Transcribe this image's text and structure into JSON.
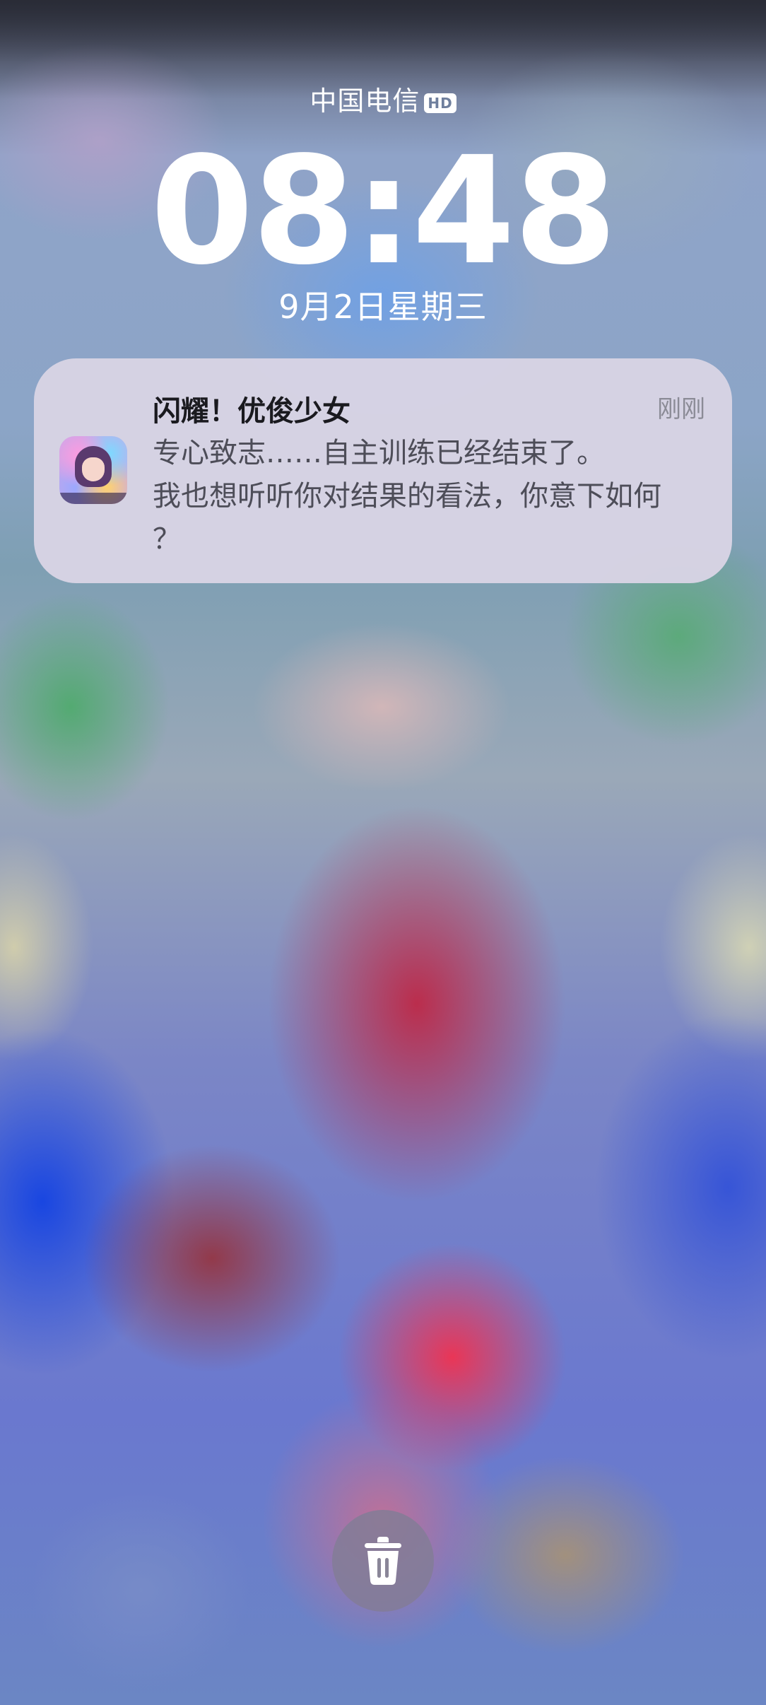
{
  "status": {
    "carrier": "中国电信",
    "network_badge": "HD"
  },
  "lockscreen": {
    "time": "08:48",
    "date": "9月2日星期三"
  },
  "notification": {
    "app_name": "闪耀！优俊少女",
    "timestamp": "刚刚",
    "message_lines": [
      "专心致志……自主训练已经结束了。",
      "我也想听听你对结果的看法，你意下如何",
      "？"
    ],
    "icon": "app-character-icon"
  },
  "actions": {
    "clear_icon": "trash-icon"
  }
}
